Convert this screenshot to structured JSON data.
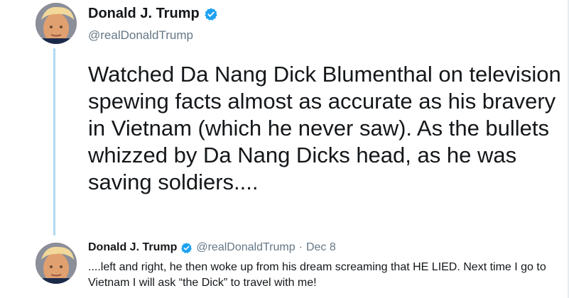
{
  "tweet": {
    "author_name": "Donald J. Trump",
    "author_handle": "@realDonaldTrump",
    "text": "Watched Da Nang Dick Blumenthal on television spewing facts almost as accurate as his bravery in Vietnam (which he never saw). As the bullets whizzed by Da Nang Dicks head, as he was saving soldiers...."
  },
  "reply": {
    "author_name": "Donald J. Trump",
    "author_handle": "@realDonaldTrump",
    "separator": "·",
    "date": "Dec 8",
    "text": "....left and right, he then woke up from his dream screaming that HE LIED. Next time I go to Vietnam I will ask “the Dick” to travel with me!"
  },
  "icons": {
    "verified": "verified-badge-icon",
    "avatar": "profile-avatar"
  },
  "colors": {
    "verified": "#1da1f2",
    "thread_line": "#b0d8ef",
    "secondary_text": "#657786"
  }
}
